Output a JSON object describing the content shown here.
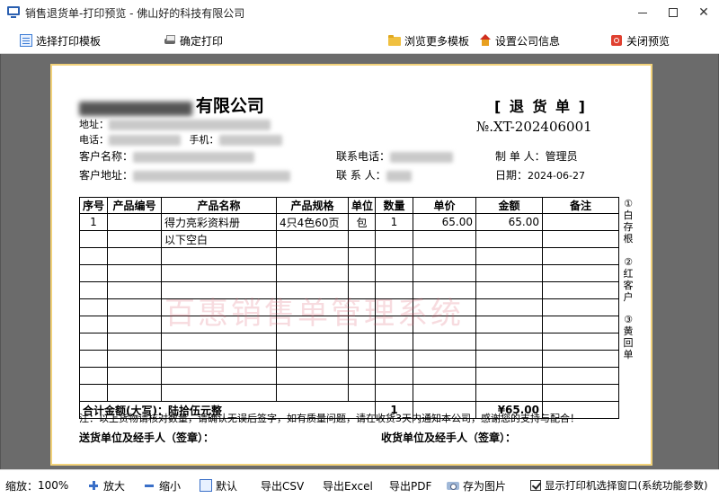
{
  "window": {
    "title": "销售退货单-打印预览 - 佛山好的科技有限公司",
    "minimize": "",
    "maximize": "",
    "close": "✕"
  },
  "toolbar": {
    "select_template": "选择打印模板",
    "confirm_print": "确定打印",
    "browse_templates": "浏览更多模板",
    "company_info": "设置公司信息",
    "close_preview": "关闭预览"
  },
  "doc": {
    "company_suffix": "有限公司",
    "title": "[ 退 货 单 ]",
    "number": "№.XT-202406001",
    "address_label": "地址：",
    "phone_label": "电话：",
    "mobile_label": "手机：",
    "customer_label": "客户名称：",
    "customer_addr_label": "客户地址：",
    "contact_phone_label": "联系电话：",
    "contact_label": "联 系 人：",
    "maker_label": "制 单 人：",
    "maker_value": "管理员",
    "date_label": "日期：",
    "date_value": "2024-06-27"
  },
  "table": {
    "headers": [
      "序号",
      "产品编号",
      "产品名称",
      "产品规格",
      "单位",
      "数量",
      "单价",
      "金额",
      "备注"
    ],
    "rows": [
      [
        "1",
        "",
        "得力亮彩资料册",
        "4只4色60页",
        "包",
        "1",
        "65.00",
        "65.00",
        ""
      ],
      [
        "",
        "",
        "以下空白",
        "",
        "",
        "",
        "",
        "",
        ""
      ]
    ],
    "total_label": "合计金额(大写)：陆拾伍元整",
    "total_qty": "1",
    "total_amount": "¥65.00"
  },
  "watermark": "百惠销售单管理系统",
  "side_notes": {
    "white": "①白存根",
    "red": "②红客户",
    "yellow": "③黄回单"
  },
  "footer": {
    "note": "注：以上货物请核对数量，请确认无误后签字，如有质量问题，请在收货3天内通知本公司，感谢您的支持与配合！",
    "sender_sign": "送货单位及经手人（签章）：",
    "receiver_sign": "收货单位及经手人（签章）："
  },
  "statusbar": {
    "zoom_label": "缩放：",
    "zoom_value": "100%",
    "zoom_in": "放大",
    "zoom_out": "缩小",
    "default": "默认",
    "export_csv": "导出CSV",
    "export_excel": "导出Excel",
    "export_pdf": "导出PDF",
    "save_image": "存为图片",
    "show_printer_dialog": "显示打印机选择窗口(系统功能参数)"
  }
}
